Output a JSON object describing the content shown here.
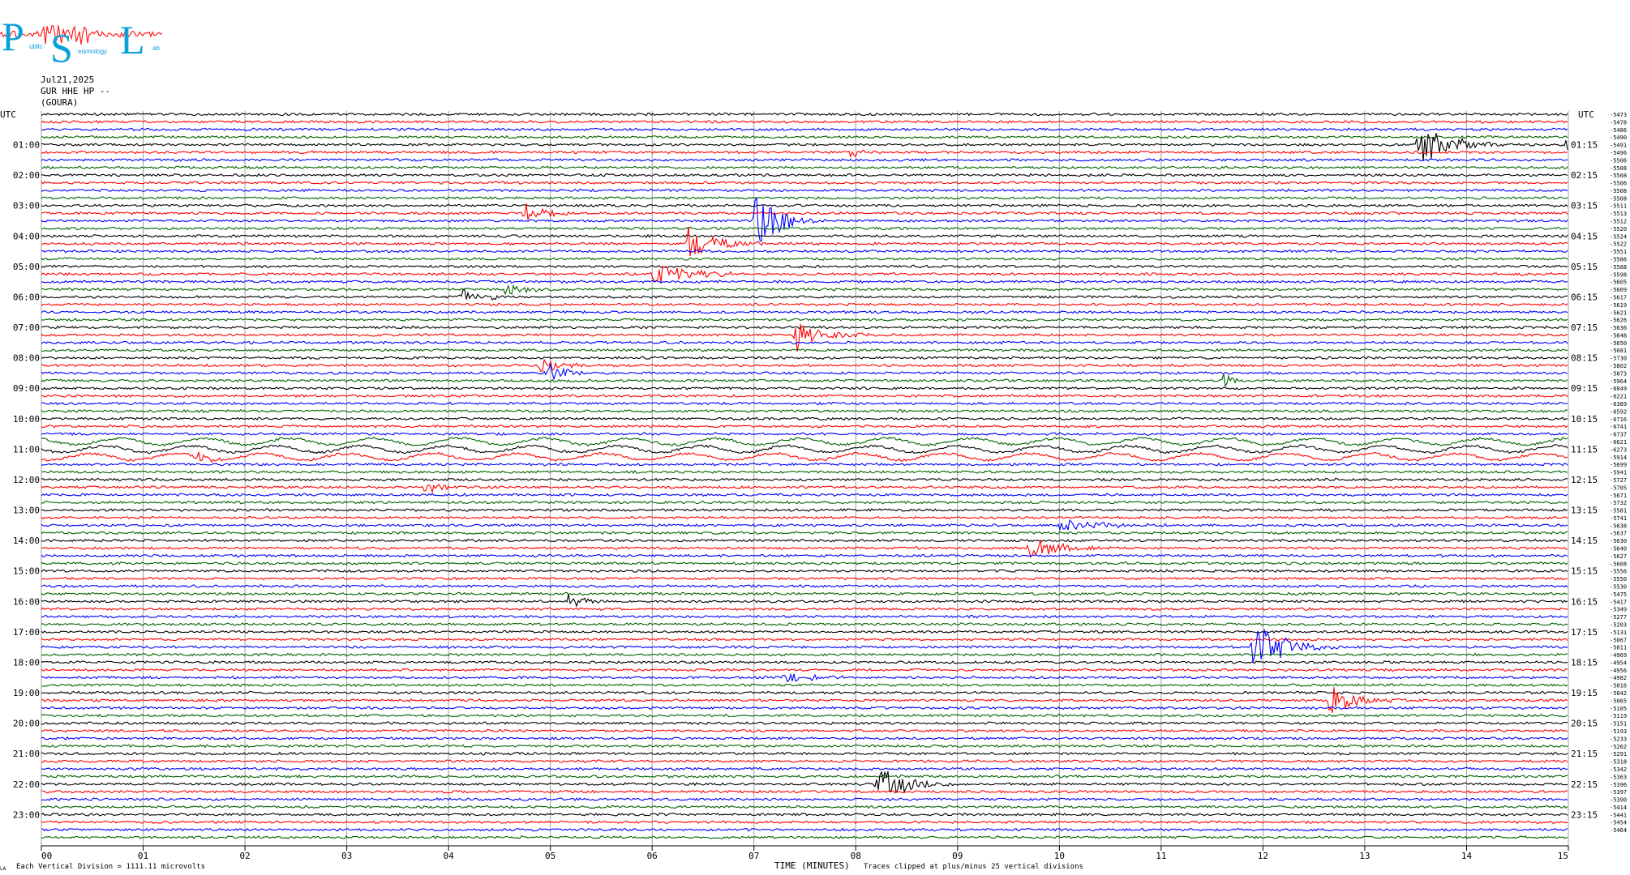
{
  "logo": {
    "letters": [
      "P",
      "S",
      "L"
    ],
    "small_text": [
      "ublic",
      "eismology",
      "ab"
    ]
  },
  "header": {
    "date": "Jul21,2025",
    "station": "GUR HHE HP --",
    "site": "(GOURA)"
  },
  "colors": {
    "trace_cycle": [
      "#000000",
      "#ff0000",
      "#0000ff",
      "#006400"
    ],
    "grid": "#a0a0a0",
    "logo": "#0aa0d8",
    "logo_trace": "#ff2020"
  },
  "footer": {
    "left_mark": "LA",
    "scale_note": "Each Vertical Division = 1111.11 microvolts",
    "clip_note": "Traces clipped at plus/minus 25 vertical divisions"
  },
  "chart_data": {
    "type": "helicorder",
    "xlabel": "TIME (MINUTES)",
    "x_ticks": [
      "00",
      "01",
      "02",
      "03",
      "04",
      "05",
      "06",
      "07",
      "08",
      "09",
      "10",
      "11",
      "12",
      "13",
      "14",
      "15"
    ],
    "xlim": [
      0,
      15
    ],
    "left_axis_title": "UTC",
    "right_axis_title": "UTC",
    "left_labels": [
      "01:00",
      "02:00",
      "03:00",
      "04:00",
      "05:00",
      "06:00",
      "07:00",
      "08:00",
      "09:00",
      "10:00",
      "11:00",
      "12:00",
      "13:00",
      "14:00",
      "15:00",
      "16:00",
      "17:00",
      "18:00",
      "19:00",
      "20:00",
      "21:00",
      "22:00",
      "23:00"
    ],
    "right_labels": [
      "01:15",
      "02:15",
      "03:15",
      "04:15",
      "05:15",
      "06:15",
      "07:15",
      "08:15",
      "09:15",
      "10:15",
      "11:15",
      "12:15",
      "13:15",
      "14:15",
      "15:15",
      "16:15",
      "17:15",
      "18:15",
      "19:15",
      "20:15",
      "21:15",
      "22:15",
      "23:15"
    ],
    "trace_count": 96,
    "trace_offsets": [
      "-5473",
      "-5478",
      "-5486",
      "-5490",
      "-5491",
      "-5496",
      "-5506",
      "-5508",
      "-5508",
      "-5506",
      "-5508",
      "-5508",
      "-5511",
      "-5513",
      "-5512",
      "-5520",
      "-5524",
      "-5522",
      "-5551",
      "-5586",
      "-5588",
      "-5598",
      "-5605",
      "-5609",
      "-5617",
      "-5619",
      "-5621",
      "-5626",
      "-5636",
      "-5648",
      "-5650",
      "-5681",
      "-5730",
      "-5802",
      "-5873",
      "-5964",
      "-6049",
      "-6221",
      "-6389",
      "-6592",
      "-6716",
      "-6741",
      "-6737",
      "-6621",
      "-6273",
      "-5914",
      "-5699",
      "-5941",
      "-5727",
      "-5705",
      "-5671",
      "-5732",
      "-5581",
      "-5741",
      "-5638",
      "-5637",
      "-5630",
      "-5640",
      "-5627",
      "-5608",
      "-5556",
      "-5550",
      "-5530",
      "-5475",
      "-5417",
      "-5349",
      "-5277",
      "-5203",
      "-5131",
      "-5067",
      "-5011",
      "-4969",
      "-4954",
      "-4956",
      "-4982",
      "-5016",
      "-5042",
      "-5065",
      "-5105",
      "-5119",
      "-5151",
      "-5193",
      "-5233",
      "-5262",
      "-5291",
      "-5318",
      "-5342",
      "-5363",
      "-5396",
      "-5397",
      "-5390",
      "-5414",
      "-5441",
      "-5454",
      "-5464",
      ""
    ],
    "events": [
      {
        "trace": 4,
        "minute": 13.5,
        "amplitude": 30,
        "duration": 0.3
      },
      {
        "trace": 5,
        "minute": 7.95,
        "amplitude": 8,
        "duration": 0.1
      },
      {
        "trace": 4,
        "minute": 14.95,
        "amplitude": 12,
        "duration": 0.1
      },
      {
        "trace": 14,
        "minute": 7.0,
        "amplitude": 34,
        "duration": 0.25
      },
      {
        "trace": 13,
        "minute": 4.75,
        "amplitude": 12,
        "duration": 0.2
      },
      {
        "trace": 17,
        "minute": 6.35,
        "amplitude": 22,
        "duration": 0.25
      },
      {
        "trace": 21,
        "minute": 6.0,
        "amplitude": 16,
        "duration": 0.35
      },
      {
        "trace": 24,
        "minute": 4.1,
        "amplitude": 12,
        "duration": 0.2
      },
      {
        "trace": 23,
        "minute": 4.55,
        "amplitude": 8,
        "duration": 0.2
      },
      {
        "trace": 29,
        "minute": 7.4,
        "amplitude": 22,
        "duration": 0.25
      },
      {
        "trace": 33,
        "minute": 4.9,
        "amplitude": 10,
        "duration": 0.2
      },
      {
        "trace": 34,
        "minute": 4.95,
        "amplitude": 14,
        "duration": 0.2
      },
      {
        "trace": 35,
        "minute": 11.6,
        "amplitude": 10,
        "duration": 0.1
      },
      {
        "trace": 45,
        "minute": 1.5,
        "amplitude": 9,
        "duration": 0.15
      },
      {
        "trace": 49,
        "minute": 3.75,
        "amplitude": 9,
        "duration": 0.2
      },
      {
        "trace": 54,
        "minute": 10.0,
        "amplitude": 9,
        "duration": 0.4
      },
      {
        "trace": 57,
        "minute": 9.7,
        "amplitude": 14,
        "duration": 0.3
      },
      {
        "trace": 64,
        "minute": 5.15,
        "amplitude": 12,
        "duration": 0.15
      },
      {
        "trace": 70,
        "minute": 11.9,
        "amplitude": 32,
        "duration": 0.3
      },
      {
        "trace": 74,
        "minute": 7.3,
        "amplitude": 8,
        "duration": 0.25
      },
      {
        "trace": 77,
        "minute": 12.65,
        "amplitude": 20,
        "duration": 0.25
      },
      {
        "trace": 88,
        "minute": 8.2,
        "amplitude": 22,
        "duration": 0.3
      }
    ]
  }
}
